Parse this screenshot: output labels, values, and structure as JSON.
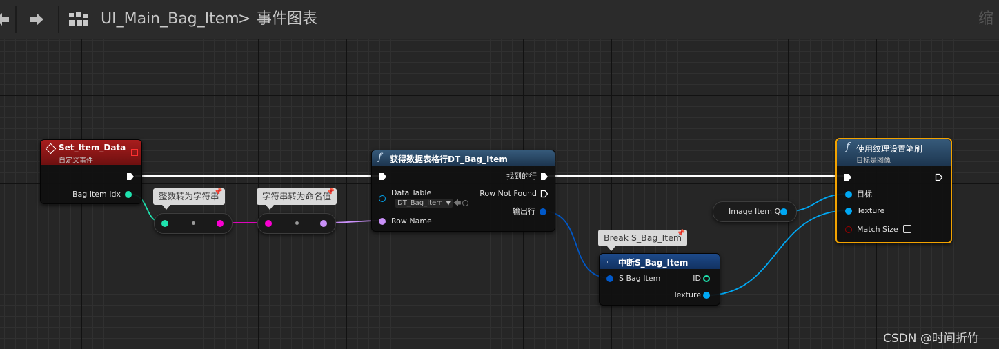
{
  "toolbar": {
    "back_icon": "arrow-left-icon",
    "forward_icon": "arrow-right-icon",
    "blueprint_icon": "event-graph-grid-icon",
    "breadcrumb_blueprint": "UI_Main_Bag_Item",
    "breadcrumb_separator": ">",
    "breadcrumb_graph": "事件图表",
    "zoom_label": "缩"
  },
  "nodes": {
    "event": {
      "title": "Set_Item_Data",
      "subtitle": "自定义事件",
      "pin_bag_item_idx": "Bag Item Idx"
    },
    "int_to_string": {
      "comment": "整数转为字符串"
    },
    "string_to_name": {
      "comment": "字符串转为命名值"
    },
    "get_data_table_row": {
      "title": "获得数据表格行DT_Bag_Item",
      "pin_data_table": "Data Table",
      "data_table_value": "DT_Bag_Item",
      "pin_row_name": "Row Name",
      "pin_row_found": "找到的行",
      "pin_row_not_found": "Row Not Found",
      "pin_out_row": "输出行"
    },
    "break_struct": {
      "comment": "Break S_Bag_Item",
      "title": "中断S_Bag_Item",
      "pin_in": "S Bag Item",
      "pin_id": "ID",
      "pin_texture": "Texture"
    },
    "image_var": {
      "label": "Image Item Q"
    },
    "set_brush": {
      "title": "使用纹理设置笔刷",
      "subtitle": "目标是图像",
      "pin_target": "目标",
      "pin_texture": "Texture",
      "pin_match_size": "Match Size"
    }
  },
  "colors": {
    "exec": "#ffffff",
    "int": "#1fe3af",
    "string": "#f900d1",
    "name": "#c990f8",
    "struct": "#0058c9",
    "object": "#00a8f4",
    "bool": "#950000",
    "event_header": "#8c1212",
    "function_header": "#2a4a66",
    "selected_border": "#f2a200"
  },
  "watermark": "CSDN @时间折竹"
}
